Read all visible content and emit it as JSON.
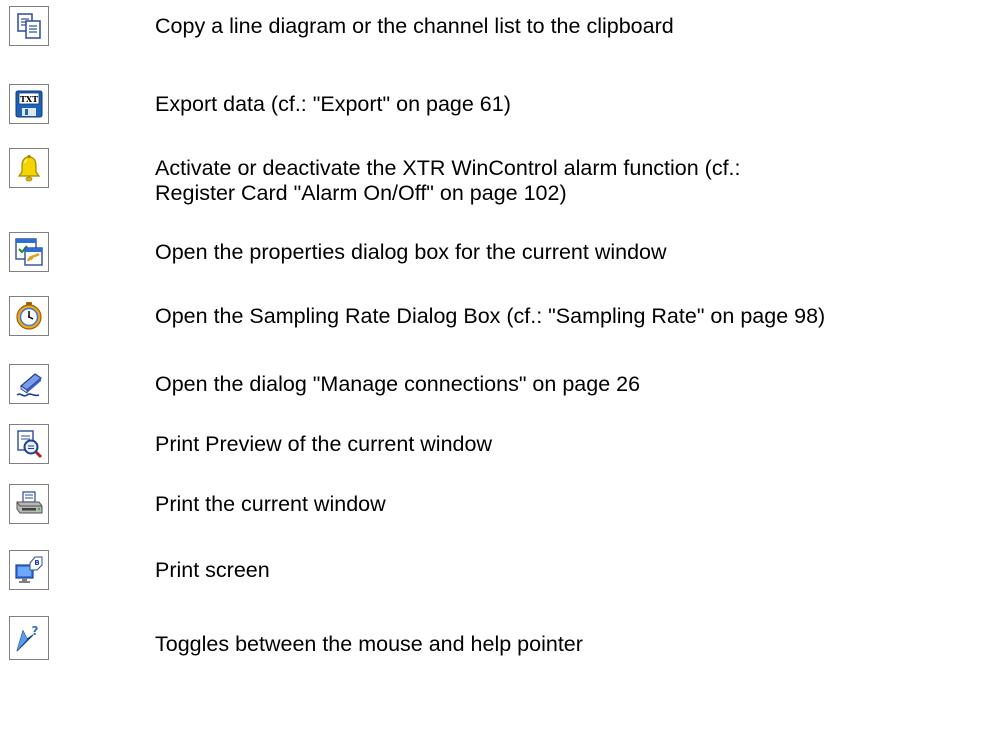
{
  "toolbar_reference": {
    "rows": [
      {
        "icon": "copy-icon",
        "text": "Copy a line diagram or the channel list to the clipboard"
      },
      {
        "icon": "export-txt-icon",
        "text": "Export data (cf.: \"Export\" on page 61)"
      },
      {
        "icon": "alarm-bell-icon",
        "text": "Activate or deactivate the XTR WinControl alarm function (cf.:\nRegister Card \"Alarm On/Off\" on page 102)"
      },
      {
        "icon": "properties-icon",
        "text": "Open the properties dialog box for the current window"
      },
      {
        "icon": "stopwatch-icon",
        "text": "Open the Sampling Rate Dialog Box (cf.: \"Sampling Rate\" on page 98)"
      },
      {
        "icon": "connections-icon",
        "text": "Open the dialog \"Manage connections\" on page 26"
      },
      {
        "icon": "print-preview-icon",
        "text": "Print Preview of the current window"
      },
      {
        "icon": "printer-icon",
        "text": "Print the current window"
      },
      {
        "icon": "print-screen-icon",
        "text": "Print screen"
      },
      {
        "icon": "help-pointer-icon",
        "text": "Toggles between the mouse and help pointer"
      }
    ]
  }
}
